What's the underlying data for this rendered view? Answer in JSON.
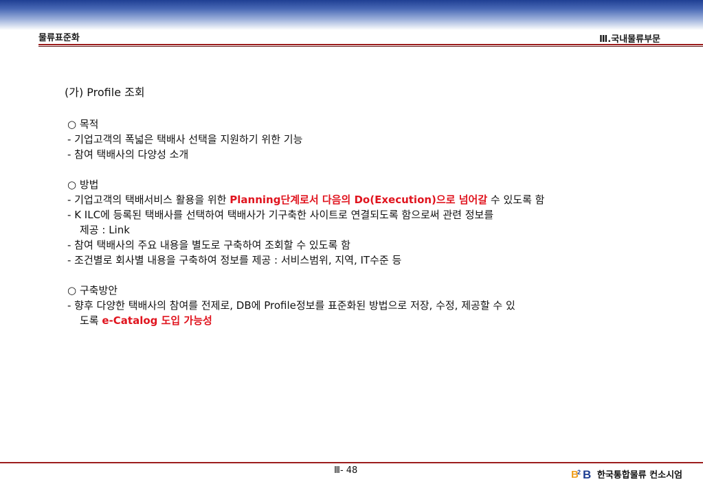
{
  "header": {
    "left_title": "물류표준화",
    "right_title": "Ⅲ.국내물류부문"
  },
  "section_title": "(가) Profile 조회",
  "purpose": {
    "heading": "○ 목적",
    "items": [
      "- 기업고객의 폭넓은 택배사 선택을 지원하기 위한 기능",
      "- 참여 택배사의 다양성 소개"
    ]
  },
  "method": {
    "heading": "○ 방법",
    "item1_pre": "- 기업고객의 택배서비스 활용을 위한 ",
    "item1_red": "Planning단계로서 다음의 Do(Execution)으로 넘어갈",
    "item1_post": " 수 있도록 함",
    "item2_line1_pre": "- ",
    "item2_line1_bold": "K ILC",
    "item2_line1_post": "에 등록된 택배사를 선택하여 택배사가 기구축한 사이트로 연결되도록 함으로써 관련 정보를",
    "item2_line2": "제공 : Link",
    "item3": "- 참여 택배사의 주요 내용을 별도로 구축하여 조회할 수 있도록 함",
    "item4": "- 조건별로 회사별 내용을 구축하여 정보를 제공 : 서비스범위, 지역, IT수준 등"
  },
  "plan": {
    "heading": "○ 구축방안",
    "line1": "- 향후 다양한 택배사의 참여를 전제로, DB에 Profile정보를 표준화된 방법으로 저장, 수정, 제공할 수 있",
    "line2_pre": "도록 ",
    "line2_red": "e-Catalog 도입 가능성"
  },
  "footer": {
    "page_number": "Ⅲ- 48",
    "organization": "한국통합물류 컨소시엄",
    "logo_icon": "b2b-logo-icon",
    "colors": {
      "logo_orange": "#f0a020",
      "logo_blue": "#1f3f93"
    }
  }
}
